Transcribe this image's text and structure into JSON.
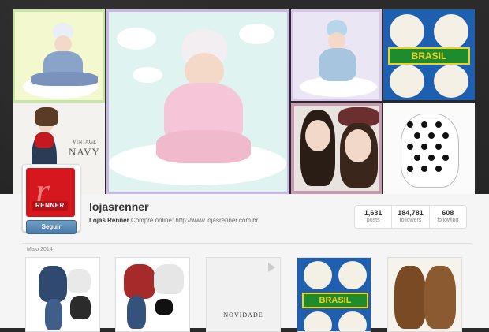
{
  "profile": {
    "username": "lojasrenner",
    "display_name": "Lojas Renner",
    "bio_text": "Compre online: http://www.lojasrenner.com.br",
    "follow_label": "Seguir",
    "avatar_badge": "RENNER"
  },
  "stats": [
    {
      "value": "1,631",
      "label": "posts"
    },
    {
      "value": "184,781",
      "label": "followers"
    },
    {
      "value": "608",
      "label": "following"
    }
  ],
  "feed": {
    "month_label": "Maio 2014",
    "novidade_text": "NOVIDADE"
  },
  "cover": {
    "vintage_line1": "VINTAGE",
    "vintage_line2": "NAVY",
    "brasil_text": "BRASIL",
    "brasil_text_small": "BRASIL"
  },
  "icons": {
    "caret": "caret-down-icon",
    "play": "play-icon"
  },
  "colors": {
    "brand_red": "#d6171e",
    "follow_blue": "#4b7ba8",
    "brasil_green": "#1f8b2f",
    "brasil_yellow": "#f1d21c"
  }
}
